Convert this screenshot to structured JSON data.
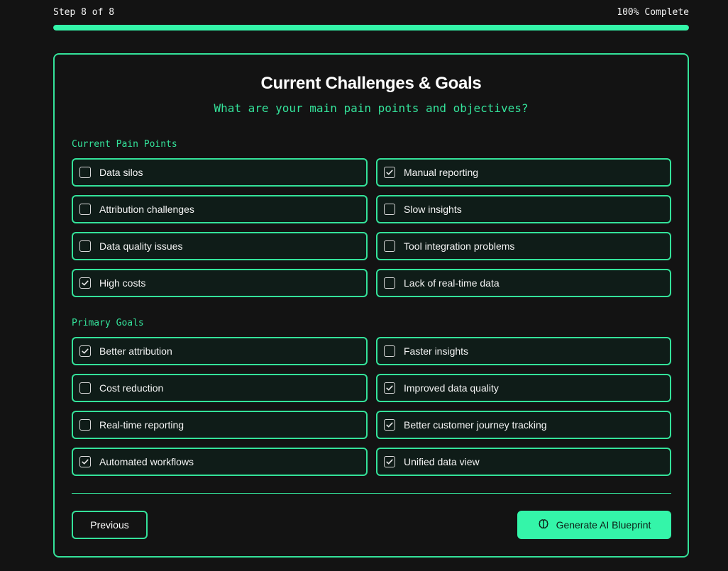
{
  "progress": {
    "step_text": "Step 8 of 8",
    "complete_text": "100% Complete",
    "percent": 100
  },
  "header": {
    "title": "Current Challenges & Goals",
    "subtitle": "What are your main pain points and objectives?"
  },
  "pain_points": {
    "label": "Current Pain Points",
    "items": [
      {
        "label": "Data silos",
        "checked": false
      },
      {
        "label": "Manual reporting",
        "checked": true
      },
      {
        "label": "Attribution challenges",
        "checked": false
      },
      {
        "label": "Slow insights",
        "checked": false
      },
      {
        "label": "Data quality issues",
        "checked": false
      },
      {
        "label": "Tool integration problems",
        "checked": false
      },
      {
        "label": "High costs",
        "checked": true
      },
      {
        "label": "Lack of real-time data",
        "checked": false
      }
    ]
  },
  "goals": {
    "label": "Primary Goals",
    "items": [
      {
        "label": "Better attribution",
        "checked": true
      },
      {
        "label": "Faster insights",
        "checked": false
      },
      {
        "label": "Cost reduction",
        "checked": false
      },
      {
        "label": "Improved data quality",
        "checked": true
      },
      {
        "label": "Real-time reporting",
        "checked": false
      },
      {
        "label": "Better customer journey tracking",
        "checked": true
      },
      {
        "label": "Automated workflows",
        "checked": true
      },
      {
        "label": "Unified data view",
        "checked": true
      }
    ]
  },
  "buttons": {
    "previous": "Previous",
    "generate": "Generate AI Blueprint",
    "generate_icon": "brain-icon"
  },
  "colors": {
    "accent": "#34e29a",
    "button_fill": "#34f5a9",
    "background": "#131313",
    "option_fill": "#0f1c18"
  }
}
